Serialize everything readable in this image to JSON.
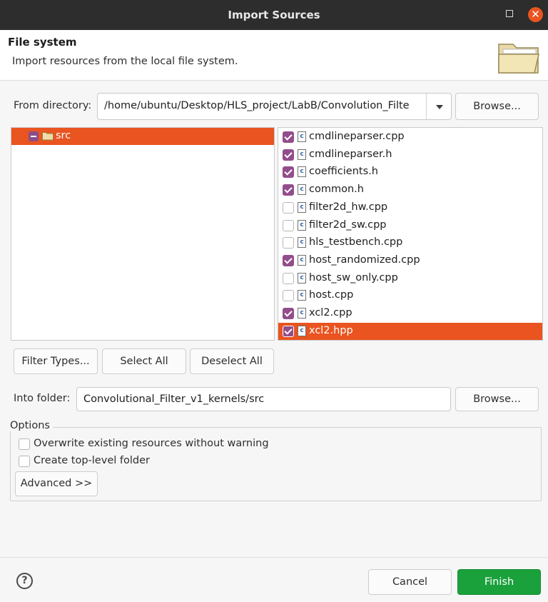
{
  "window": {
    "title": "Import Sources",
    "minimize_icon": "minimize-icon",
    "close_icon": "close-icon",
    "close_glyph": "✕"
  },
  "header": {
    "title": "File system",
    "description": "Import resources from the local file system.",
    "icon": "folder-open-icon"
  },
  "from_directory": {
    "label": "From directory:",
    "value": "/home/ubuntu/Desktop/HLS_project/LabB/Convolution_Filte",
    "browse_label": "Browse..."
  },
  "tree": {
    "items": [
      {
        "label": "src",
        "selected": true,
        "expanded": true
      }
    ]
  },
  "files": [
    {
      "name": "cmdlineparser.cpp",
      "checked": true,
      "selected": false
    },
    {
      "name": "cmdlineparser.h",
      "checked": true,
      "selected": false
    },
    {
      "name": "coefficients.h",
      "checked": true,
      "selected": false
    },
    {
      "name": "common.h",
      "checked": true,
      "selected": false
    },
    {
      "name": "filter2d_hw.cpp",
      "checked": false,
      "selected": false
    },
    {
      "name": "filter2d_sw.cpp",
      "checked": false,
      "selected": false
    },
    {
      "name": "hls_testbench.cpp",
      "checked": false,
      "selected": false
    },
    {
      "name": "host_randomized.cpp",
      "checked": true,
      "selected": false
    },
    {
      "name": "host_sw_only.cpp",
      "checked": false,
      "selected": false
    },
    {
      "name": "host.cpp",
      "checked": false,
      "selected": false
    },
    {
      "name": "xcl2.cpp",
      "checked": true,
      "selected": false
    },
    {
      "name": "xcl2.hpp",
      "checked": true,
      "selected": true
    }
  ],
  "file_icon_glyph": "c",
  "selection_buttons": {
    "filter_types": "Filter Types...",
    "select_all": "Select All",
    "deselect_all": "Deselect All"
  },
  "into_folder": {
    "label": "Into folder:",
    "value": "Convolutional_Filter_v1_kernels/src",
    "browse_label": "Browse..."
  },
  "options": {
    "label": "Options",
    "overwrite": {
      "label": "Overwrite existing resources without warning",
      "checked": false
    },
    "top_level": {
      "label": "Create top-level folder",
      "checked": false
    },
    "advanced_label": "Advanced >>"
  },
  "footer": {
    "help_glyph": "?",
    "cancel_label": "Cancel",
    "finish_label": "Finish"
  },
  "colors": {
    "accent": "#e95420",
    "checkbox": "#924d8b",
    "finish": "#1aa13c",
    "titlebar": "#2d2d2d"
  }
}
